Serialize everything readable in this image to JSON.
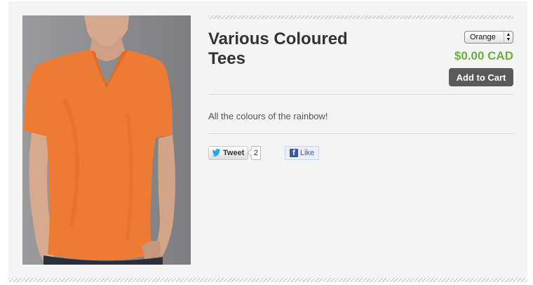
{
  "product": {
    "title": "Various Coloured Tees",
    "price": "$0.00 CAD",
    "description": "All the colours of the rainbow!",
    "add_to_cart_label": "Add to Cart",
    "colors": {
      "price": "#6cae3c",
      "shirt": "#ee7b34",
      "button": "#5a5a5a"
    }
  },
  "variant_select": {
    "selected": "Orange"
  },
  "social": {
    "tweet_label": "Tweet",
    "tweet_count": "2",
    "like_label": "Like",
    "fb_glyph": "f"
  }
}
